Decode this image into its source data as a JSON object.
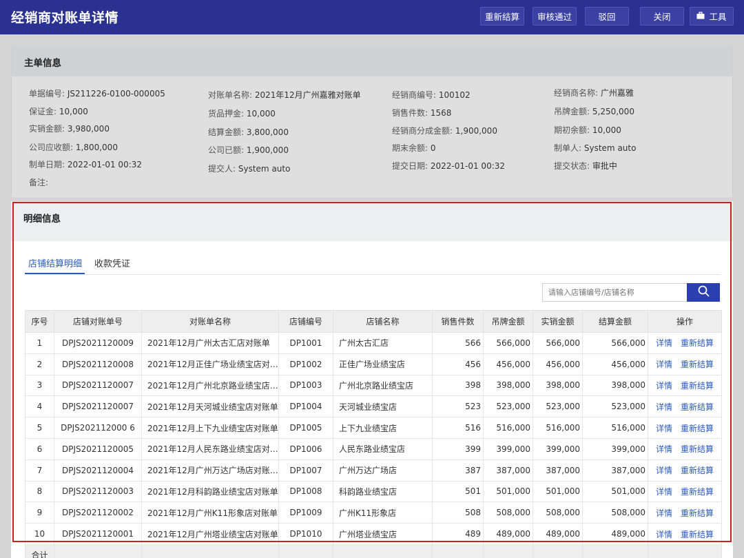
{
  "app": {
    "title": "经销商对账单详情"
  },
  "toolbar": {
    "resettle": "重新结算",
    "approve": "审核通过",
    "reject": "驳回",
    "close": "关闭",
    "tools": "工具"
  },
  "main_info": {
    "title": "主单信息",
    "fields": {
      "doc_no": {
        "label": "单据编号:",
        "value": "JS211226-0100-000005"
      },
      "bill_name": {
        "label": "对账单名称:",
        "value": "2021年12月广州嘉雅对账单"
      },
      "dealer_no": {
        "label": "经销商编号:",
        "value": "100102"
      },
      "dealer_name": {
        "label": "经销商名称:",
        "value": "广州嘉雅"
      },
      "deposit": {
        "label": "保证金:",
        "value": "10,000"
      },
      "goods_pledge": {
        "label": "货品押金:",
        "value": "10,000"
      },
      "sales_qty": {
        "label": "销售件数:",
        "value": "1568"
      },
      "tag_amount": {
        "label": "吊牌金额:",
        "value": "5,250,000"
      },
      "actual_amount": {
        "label": "实销金额:",
        "value": "3,980,000"
      },
      "settle_amount": {
        "label": "结算金额:",
        "value": "3,800,000"
      },
      "dealer_share": {
        "label": "经销商分成金额:",
        "value": "1,900,000"
      },
      "opening_balance": {
        "label": "期初余额:",
        "value": "10,000"
      },
      "receivable": {
        "label": "公司应收额:",
        "value": "1,800,000"
      },
      "received": {
        "label": "公司已额:",
        "value": "1,900,000"
      },
      "closing_balance": {
        "label": "期末余额:",
        "value": "0"
      },
      "creator": {
        "label": "制单人:",
        "value": "System  auto"
      },
      "created_at": {
        "label": "制单日期:",
        "value": "2022-01-01 00:32"
      },
      "submitter": {
        "label": "提交人:",
        "value": "System  auto"
      },
      "submitted_at": {
        "label": "提交日期:",
        "value": "2022-01-01 00:32"
      },
      "submit_status": {
        "label": "提交状态:",
        "value": "审批中"
      },
      "remark": {
        "label": "备注:",
        "value": ""
      }
    }
  },
  "detail": {
    "title": "明细信息",
    "tabs": [
      "店铺结算明细",
      "收款凭证"
    ],
    "search_placeholder": "请输入店铺编号/店铺名称",
    "columns": [
      "序号",
      "店铺对账单号",
      "对账单名称",
      "店铺编号",
      "店铺名称",
      "销售件数",
      "吊牌金额",
      "实销金额",
      "结算金额",
      "操作"
    ],
    "action_detail": "详情",
    "action_resettle": "重新结算",
    "rows": [
      [
        "1",
        "DPJS2021120009",
        "2021年12月广州太古汇店对账单",
        "DP1001",
        "广州太古汇店",
        "566",
        "566,000",
        "566,000",
        "566,000"
      ],
      [
        "2",
        "DPJS2021120008",
        "2021年12月正佳广场业绩宝店对…",
        "DP1002",
        "正佳广场业绩宝店",
        "456",
        "456,000",
        "456,000",
        "456,000"
      ],
      [
        "3",
        "DPJS2021120007",
        "2021年12月广州北京路业绩宝店…",
        "DP1003",
        "广州北京路业绩宝店",
        "398",
        "398,000",
        "398,000",
        "398,000"
      ],
      [
        "4",
        "DPJS2021120007",
        "2021年12月天河城业绩宝店对账单",
        "DP1004",
        "天河城业绩宝店",
        "523",
        "523,000",
        "523,000",
        "523,000"
      ],
      [
        "5",
        "DPJS202112000 6",
        "2021年12月上下九业绩宝店对账单",
        "DP1005",
        "上下九业绩宝店",
        "516",
        "516,000",
        "516,000",
        "516,000"
      ],
      [
        "6",
        "DPJS2021120005",
        "2021年12月人民东路业绩宝店对…",
        "DP1006",
        "人民东路业绩宝店",
        "399",
        "399,000",
        "399,000",
        "399,000"
      ],
      [
        "7",
        "DPJS2021120004",
        "2021年12月广州万达广场店对账…",
        "DP1007",
        "广州万达广场店",
        "387",
        "387,000",
        "387,000",
        "387,000"
      ],
      [
        "8",
        "DPJS2021120003",
        "2021年12月科韵路业绩宝店对账单",
        "DP1008",
        "科韵路业绩宝店",
        "501",
        "501,000",
        "501,000",
        "501,000"
      ],
      [
        "9",
        "DPJS2021120002",
        "2021年12月广州K11形象店对账单",
        "DP1009",
        "广州K11形象店",
        "508",
        "508,000",
        "508,000",
        "508,000"
      ],
      [
        "10",
        "DPJS2021120001",
        "2021年12月广州塔业绩宝店对账单",
        "DP1010",
        "广州塔业绩宝店",
        "489",
        "489,000",
        "489,000",
        "489,000"
      ]
    ],
    "total_label": "合计"
  },
  "colors": {
    "topbar": "#2b3190",
    "accent": "#2b5bb8",
    "highlight_frame": "#cc1f1f"
  },
  "icons": {
    "tools": "briefcase-icon",
    "search": "search-icon"
  }
}
